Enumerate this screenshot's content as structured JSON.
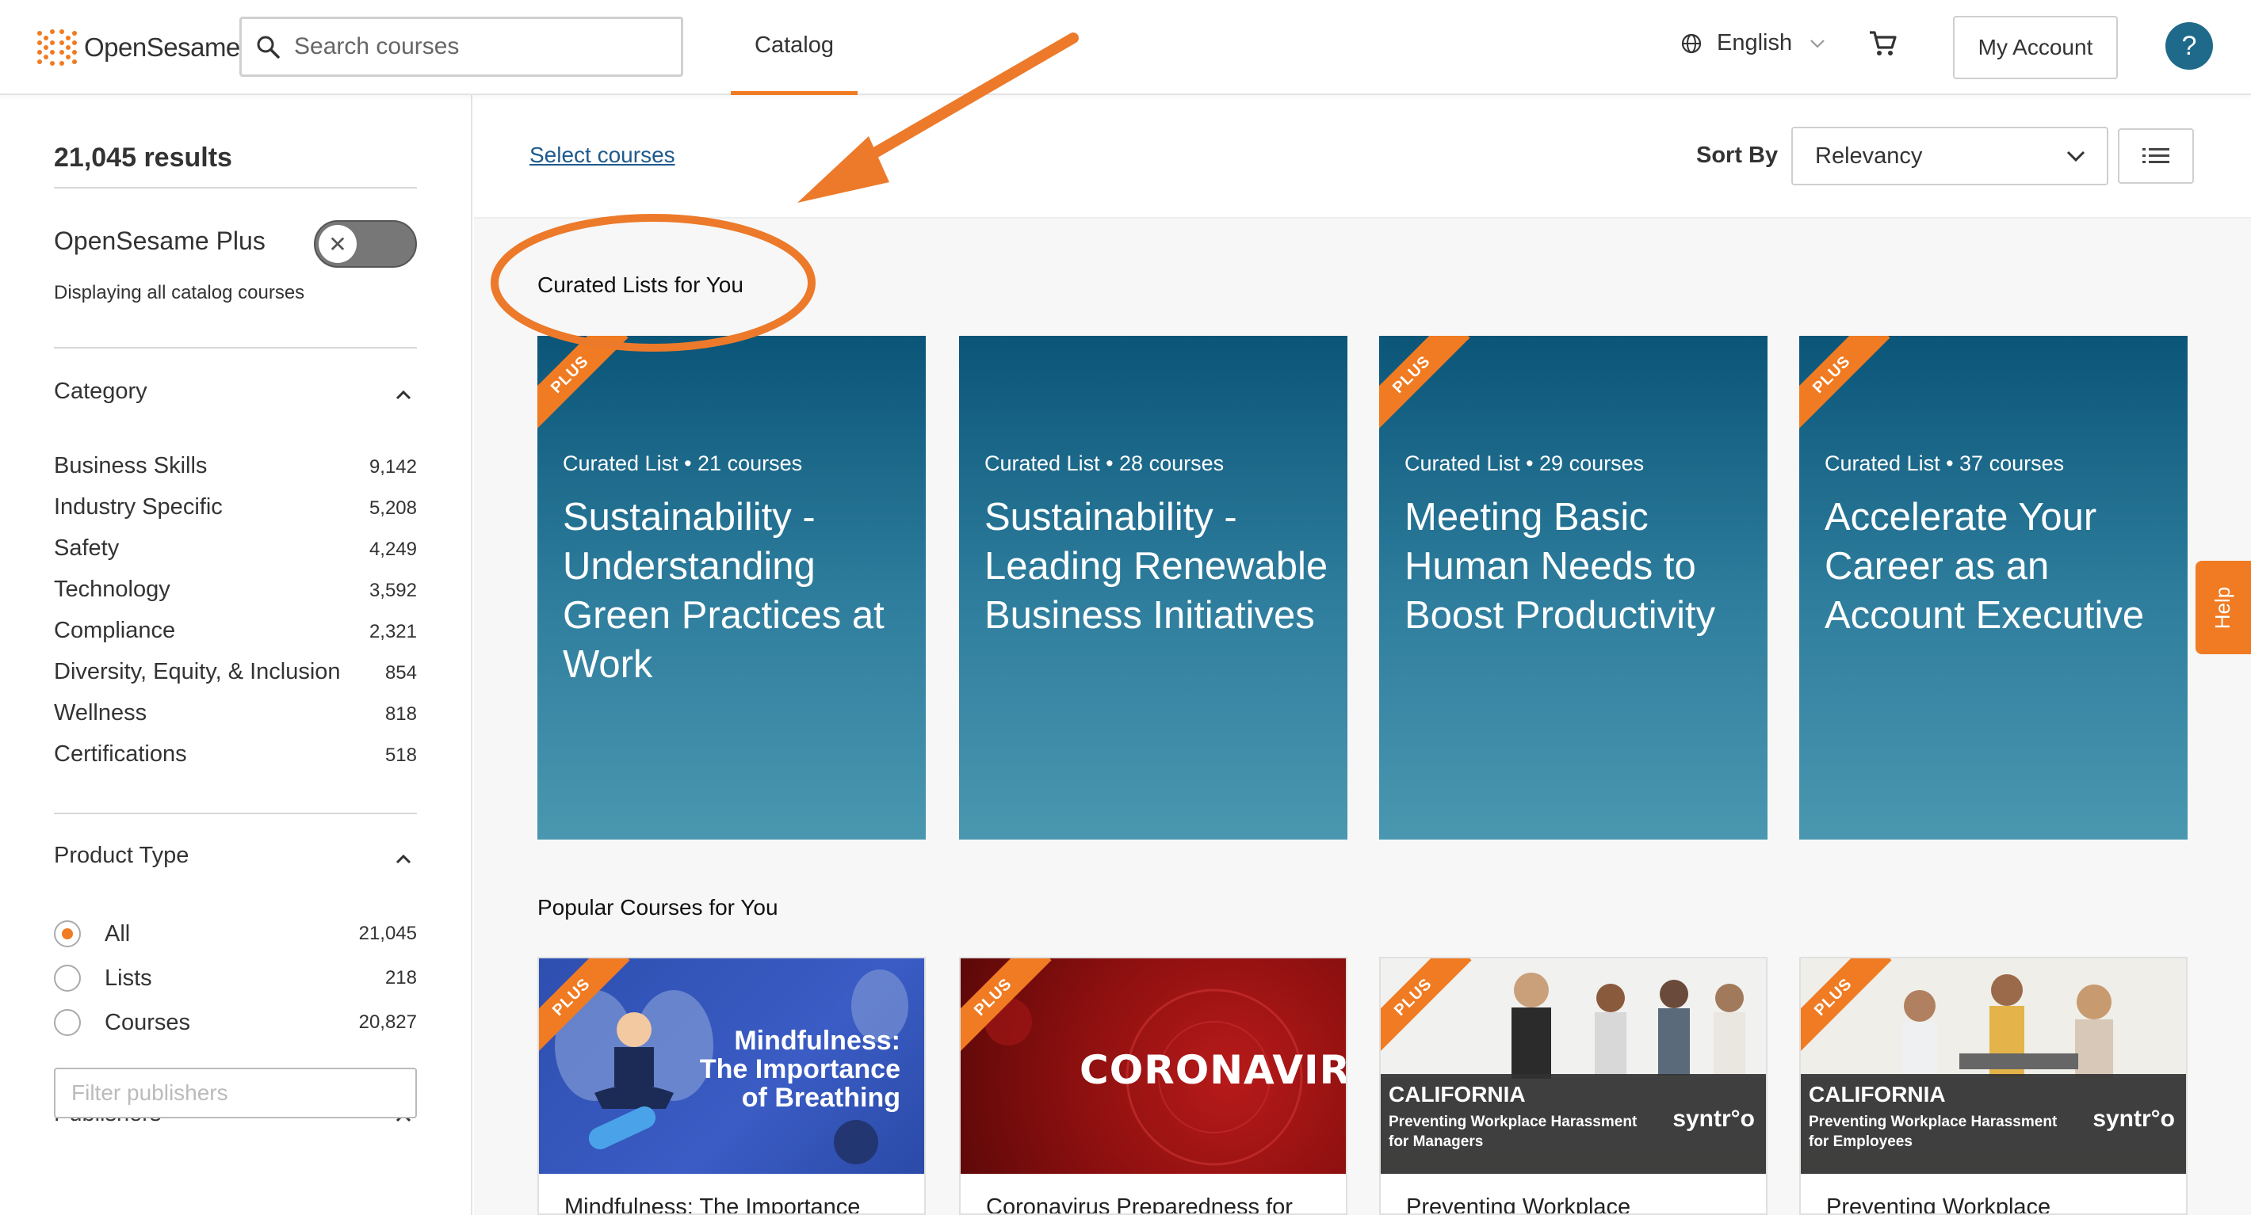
{
  "header": {
    "logo_text": "OpenSesame",
    "search_placeholder": "Search courses",
    "nav_catalog": "Catalog",
    "language": "English",
    "account_label": "My Account",
    "help_symbol": "?",
    "accent_color": "#f07b22",
    "icons": [
      "search-icon",
      "globe-icon",
      "chevron-down-icon",
      "cart-icon",
      "help-icon"
    ]
  },
  "sidebar": {
    "results": "21,045 results",
    "plus_label": "OpenSesame Plus",
    "plus_toggle_symbol": "✕",
    "plus_sub": "Displaying all catalog courses",
    "category": {
      "title": "Category",
      "items": [
        {
          "name": "Business Skills",
          "count": "9,142"
        },
        {
          "name": "Industry Specific",
          "count": "5,208"
        },
        {
          "name": "Safety",
          "count": "4,249"
        },
        {
          "name": "Technology",
          "count": "3,592"
        },
        {
          "name": "Compliance",
          "count": "2,321"
        },
        {
          "name": "Diversity, Equity, & Inclusion",
          "count": "854"
        },
        {
          "name": "Wellness",
          "count": "818"
        },
        {
          "name": "Certifications",
          "count": "518"
        }
      ]
    },
    "product_type": {
      "title": "Product Type",
      "items": [
        {
          "name": "All",
          "count": "21,045",
          "selected": true
        },
        {
          "name": "Lists",
          "count": "218",
          "selected": false
        },
        {
          "name": "Courses",
          "count": "20,827",
          "selected": false
        }
      ]
    },
    "publishers": {
      "title": "Publishers",
      "filter_placeholder": "Filter publishers"
    }
  },
  "main": {
    "select_courses": "Select courses",
    "sort_label": "Sort By",
    "sort_value": "Relevancy",
    "curated_heading": "Curated Lists for You",
    "popular_heading": "Popular Courses for You",
    "plus_badge": "PLUS",
    "curated_cards": [
      {
        "meta": "Curated List • 21 courses",
        "title": "Sustainability - Understanding Green Practices at Work",
        "plus": true
      },
      {
        "meta": "Curated List • 28 courses",
        "title": "Sustainability - Leading Renewable Business Initiatives",
        "plus": false
      },
      {
        "meta": "Curated List • 29 courses",
        "title": "Meeting Basic Human Needs to Boost Productivity",
        "plus": true
      },
      {
        "meta": "Curated List • 37 courses",
        "title": "Accelerate Your Career as an Account Executive",
        "plus": true
      }
    ],
    "popular_cards": [
      {
        "title": "Mindfulness: The Importance",
        "image_text": "Mindfulness:\nThe Importance\nof Breathing"
      },
      {
        "title": "Coronavirus Preparedness for",
        "image_text": "CORONAVIRUS"
      },
      {
        "title": "Preventing Workplace",
        "banner_state": "CALIFORNIA",
        "banner_sub": "Preventing Workplace Harassment for Managers",
        "banner_brand": "syntr°o"
      },
      {
        "title": "Preventing Workplace",
        "banner_state": "CALIFORNIA",
        "banner_sub": "Preventing Workplace Harassment for Employees",
        "banner_brand": "syntr°o"
      }
    ]
  },
  "help_tab": "Help"
}
